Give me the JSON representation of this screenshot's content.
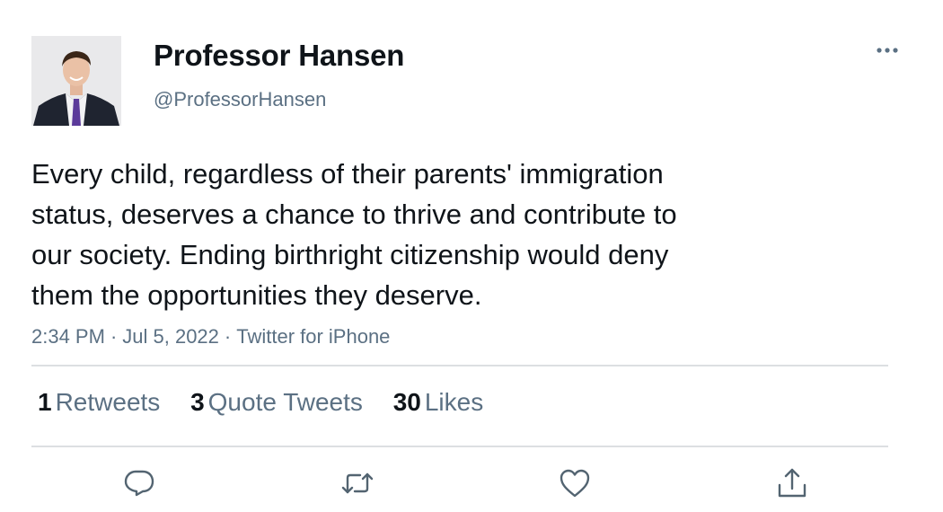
{
  "author": {
    "display_name": "Professor Hansen",
    "handle": "@ProfessorHansen"
  },
  "tweet": {
    "text_lines": [
      "Every child, regardless of their parents' immigration",
      "status, deserves a chance to thrive and contribute to",
      "our society. Ending birthright citizenship would deny",
      "them the opportunities they deserve."
    ],
    "time": "2:34 PM",
    "date": "Jul 5, 2022",
    "source": "Twitter for iPhone",
    "separator": "·"
  },
  "stats": {
    "retweets_count": "1",
    "retweets_label": "Retweets",
    "quotes_count": "3",
    "quotes_label": "Quote Tweets",
    "likes_count": "30",
    "likes_label": "Likes"
  },
  "actions": {
    "reply_icon": "reply-icon",
    "retweet_icon": "retweet-icon",
    "like_icon": "heart-icon",
    "share_icon": "share-icon",
    "more_icon": "more-icon"
  },
  "colors": {
    "text": "#0f1419",
    "secondary": "#5b7083",
    "divider": "#dcdfe2",
    "icon": "#536471"
  }
}
